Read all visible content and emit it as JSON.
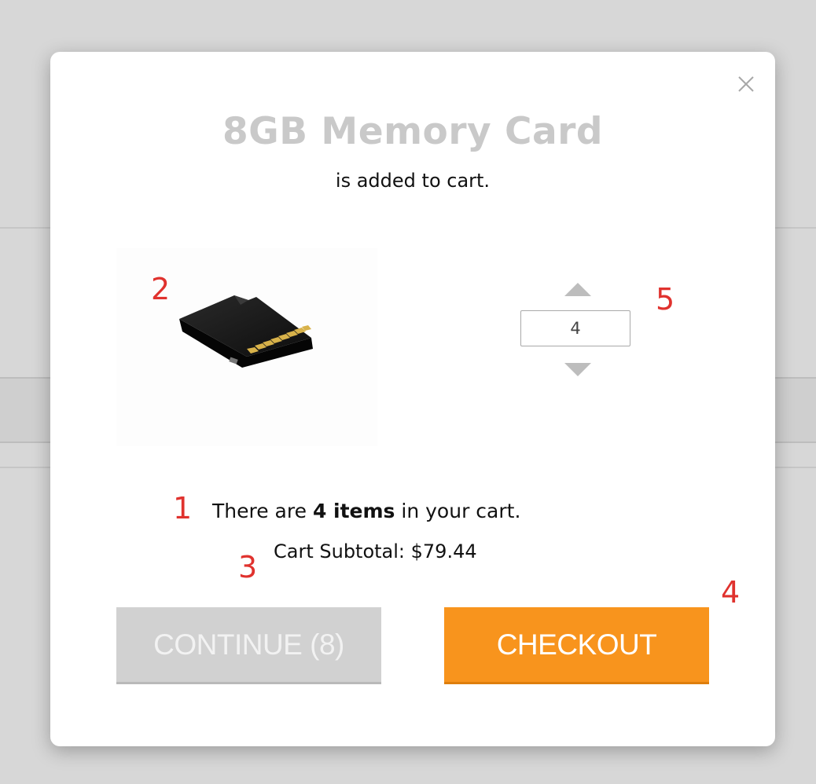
{
  "modal": {
    "product_title": "8GB Memory Card",
    "added_text": "is added to cart.",
    "product_image": "sd-card-image",
    "quantity": "4",
    "cart_summary": {
      "prefix": "There are ",
      "count_text": "4 items",
      "suffix": " in your cart."
    },
    "subtotal_text": "Cart Subtotal: $79.44",
    "continue_label": "CONTINUE (8)",
    "checkout_label": "CHECKOUT",
    "close_icon": "close-icon",
    "stepper_icons": [
      "arrow-up-icon",
      "arrow-down-icon"
    ]
  },
  "annotations": {
    "n1": "1",
    "n2": "2",
    "n3": "3",
    "n4": "4",
    "n5": "5"
  },
  "colors": {
    "title": "#c9c9c9",
    "checkout": "#f8941d",
    "continue": "#d1d1d1",
    "annotation": "#e0322e"
  }
}
